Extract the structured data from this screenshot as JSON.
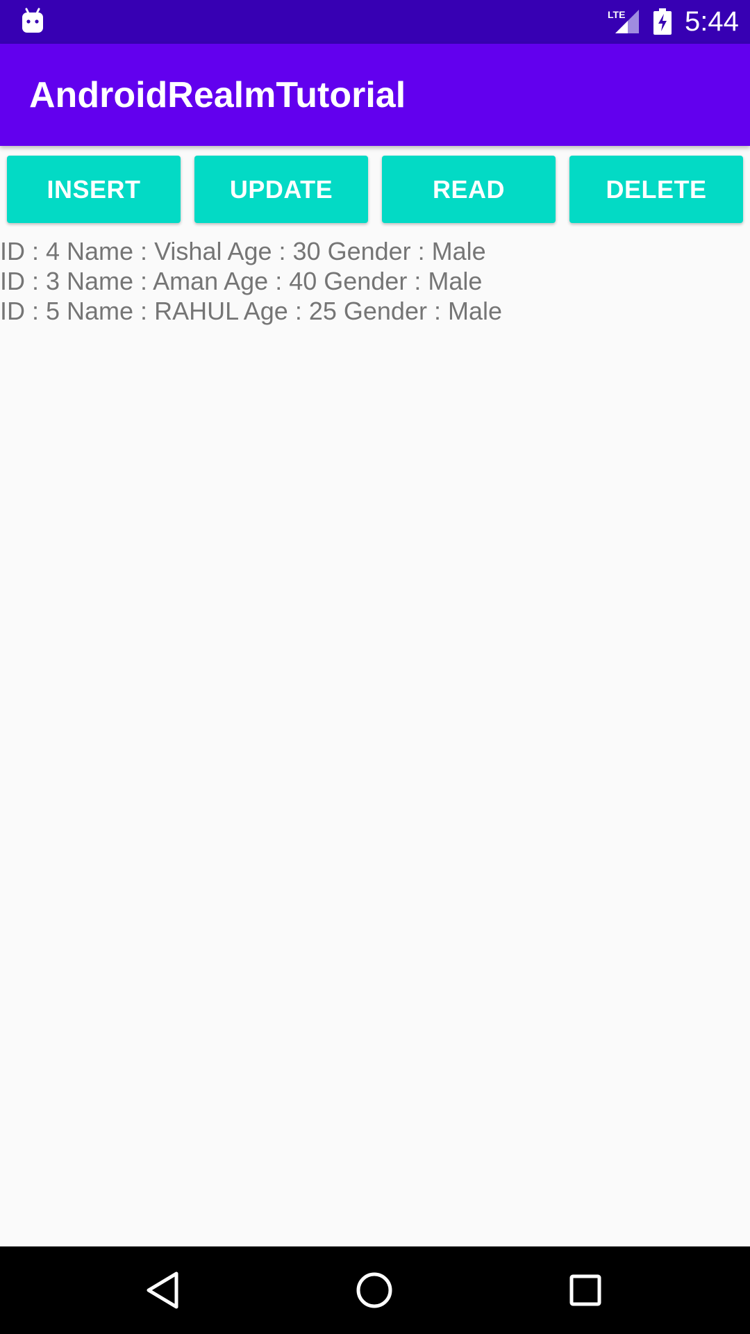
{
  "status_bar": {
    "time": "5:44",
    "network_label": "LTE",
    "icons": [
      "android-notification-icon",
      "lte-signal-icon",
      "battery-charging-icon"
    ]
  },
  "app_bar": {
    "title": "AndroidRealmTutorial"
  },
  "buttons": {
    "insert": "INSERT",
    "update": "UPDATE",
    "read": "READ",
    "delete": "DELETE"
  },
  "records": [
    "ID : 4 Name : Vishal Age : 30 Gender : Male",
    "ID : 3 Name : Aman Age : 40 Gender : Male",
    "ID : 5 Name : RAHUL Age : 25 Gender : Male"
  ],
  "navigation": {
    "icons": [
      "back-icon",
      "home-icon",
      "recents-icon"
    ]
  },
  "colors": {
    "status_bar": "#3700b3",
    "app_bar": "#6200ee",
    "button": "#03dac5",
    "record_text": "#757575",
    "background": "#fafafa",
    "nav_bar": "#000000"
  }
}
